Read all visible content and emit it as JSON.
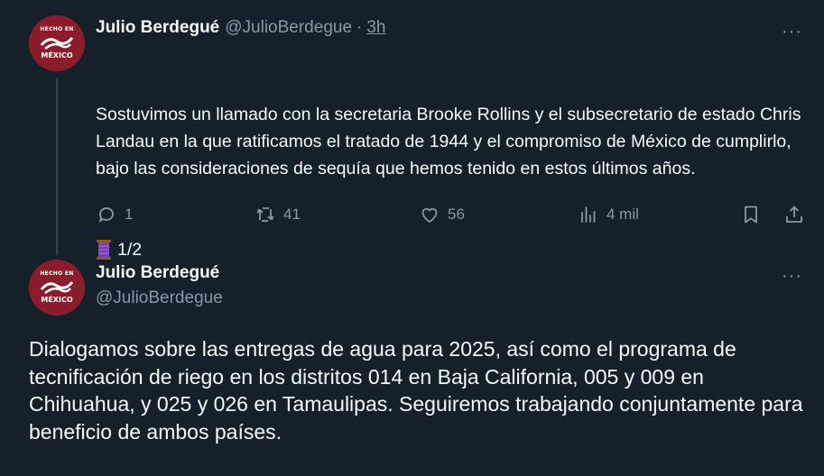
{
  "tweet1": {
    "author_name": "Julio Berdegué",
    "author_handle": "@JulioBerdegue",
    "separator": "·",
    "time": "3h",
    "text": "Sostuvimos un llamado con la secretaria Brooke Rollins y el subsecretario de estado Chris Landau en la que ratificamos el tratado de 1944 y el compromiso de México de cumplirlo, bajo las consideraciones de sequía que hemos tenido en estos últimos años.",
    "thread_marker": "1/2",
    "more_label": "···",
    "actions": {
      "replies": "1",
      "reposts": "41",
      "likes": "56",
      "views": "4 mil"
    }
  },
  "tweet2": {
    "author_name": "Julio Berdegué",
    "author_handle": "@JulioBerdegue",
    "more_label": "···",
    "text": "Dialogamos sobre las entregas de agua para 2025, así como el programa de tecnificación de riego en los distritos 014 en Baja California, 005 y 009 en Chihuahua, y 025 y 026 en Tamaulipas. Seguiremos trabajando conjuntamente para beneficio de ambos países."
  },
  "avatar": {
    "top_text": "HECHO EN",
    "bottom_text": "MÉXICO"
  },
  "colors": {
    "background": "#15202b",
    "text_primary": "#f7f9f9",
    "text_secondary": "#8b98a5",
    "thread_line": "#38444d",
    "avatar_red": "#8b1c2c"
  },
  "icons": {
    "reply": "reply-icon",
    "repost": "repost-icon",
    "like": "heart-icon",
    "views": "views-icon",
    "bookmark": "bookmark-icon",
    "share": "share-icon",
    "thread_emoji": "spool-of-thread-icon"
  }
}
